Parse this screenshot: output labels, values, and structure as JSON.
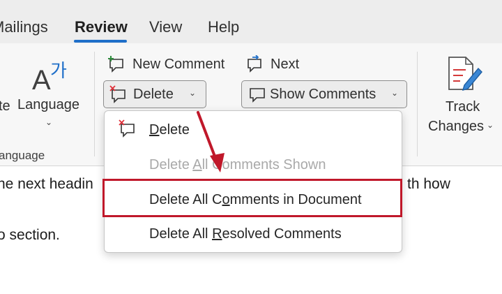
{
  "tabs": [
    "Mailings",
    "Review",
    "View",
    "Help"
  ],
  "ribbon": {
    "partial_left": "te",
    "language_label": "Language",
    "language_group_label": "anguage",
    "new_comment": "New Comment",
    "next": "Next",
    "delete": "Delete",
    "show_comments": "Show Comments",
    "track_line1": "Track",
    "track_line2": "Changes"
  },
  "icons": {
    "language": "language-icon",
    "new_comment": "new-comment-icon",
    "next_comment": "next-comment-icon",
    "delete_comment": "delete-comment-icon",
    "show_comments": "show-comments-icon",
    "track_changes": "track-changes-icon"
  },
  "document": {
    "line1_left": "ne next headin",
    "line1_right": "th how",
    "line2": "o section."
  },
  "menu": {
    "items": [
      {
        "pre": "",
        "mn": "D",
        "post": "elete"
      },
      {
        "pre": "Delete ",
        "mn": "A",
        "post": "ll Comments Shown"
      },
      {
        "pre": "Delete All C",
        "mn": "o",
        "post": "mments in Document"
      },
      {
        "pre": "Delete All ",
        "mn": "R",
        "post": "esolved Comments"
      }
    ]
  },
  "colors": {
    "accent": "#1f6fc9",
    "highlight": "#c0182a",
    "delete_icon_x": "#e0303a",
    "new_comment_green": "#2e8b3c"
  }
}
